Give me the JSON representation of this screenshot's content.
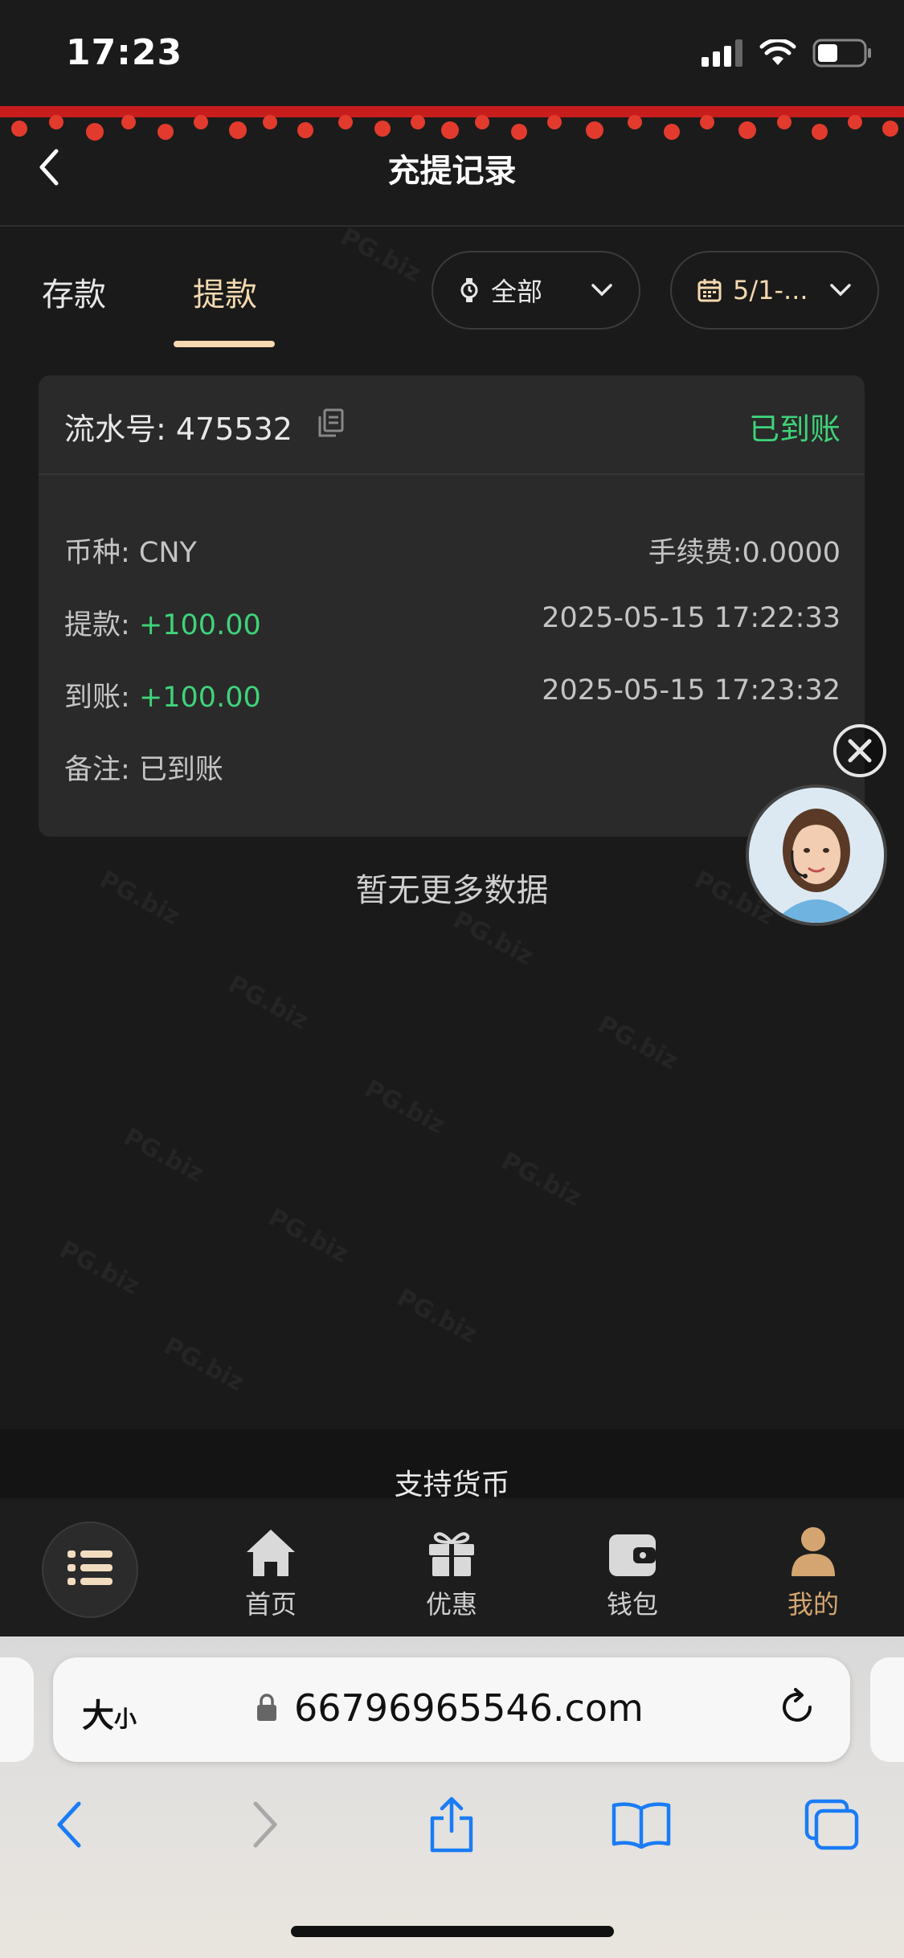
{
  "status_bar": {
    "time": "17:23"
  },
  "header": {
    "title": "充提记录"
  },
  "tabs": [
    {
      "label": "存款",
      "active": false
    },
    {
      "label": "提款",
      "active": true
    }
  ],
  "filters": {
    "status": {
      "value": "全部",
      "icon": "clock-icon"
    },
    "date": {
      "value": "5/1-...",
      "icon": "calendar-icon"
    }
  },
  "record": {
    "serial_label": "流水号: 475532",
    "status": "已到账",
    "currency": "币种: CNY",
    "fee": "手续费:0.0000",
    "withdraw_label": "提款:",
    "withdraw_amount": "+100.00",
    "withdraw_time": "2025-05-15 17:22:33",
    "arrive_label": "到账:",
    "arrive_amount": "+100.00",
    "arrive_time": "2025-05-15 17:23:32",
    "note": "备注: 已到账"
  },
  "empty_hint": "暂无更多数据",
  "currency_banner": "支持货币",
  "bottom_nav": [
    {
      "label": "首页",
      "icon": "home-icon",
      "active": false
    },
    {
      "label": "优惠",
      "icon": "gift-icon",
      "active": false
    },
    {
      "label": "钱包",
      "icon": "wallet-icon",
      "active": false
    },
    {
      "label": "我的",
      "icon": "user-icon",
      "active": true
    }
  ],
  "browser": {
    "text_size_big": "大",
    "text_size_small": "小",
    "url": "66796965546.com"
  },
  "colors": {
    "accent_gold": "#f5d9b0",
    "success_green": "#3fd37a",
    "active_nav": "#d4a570"
  }
}
